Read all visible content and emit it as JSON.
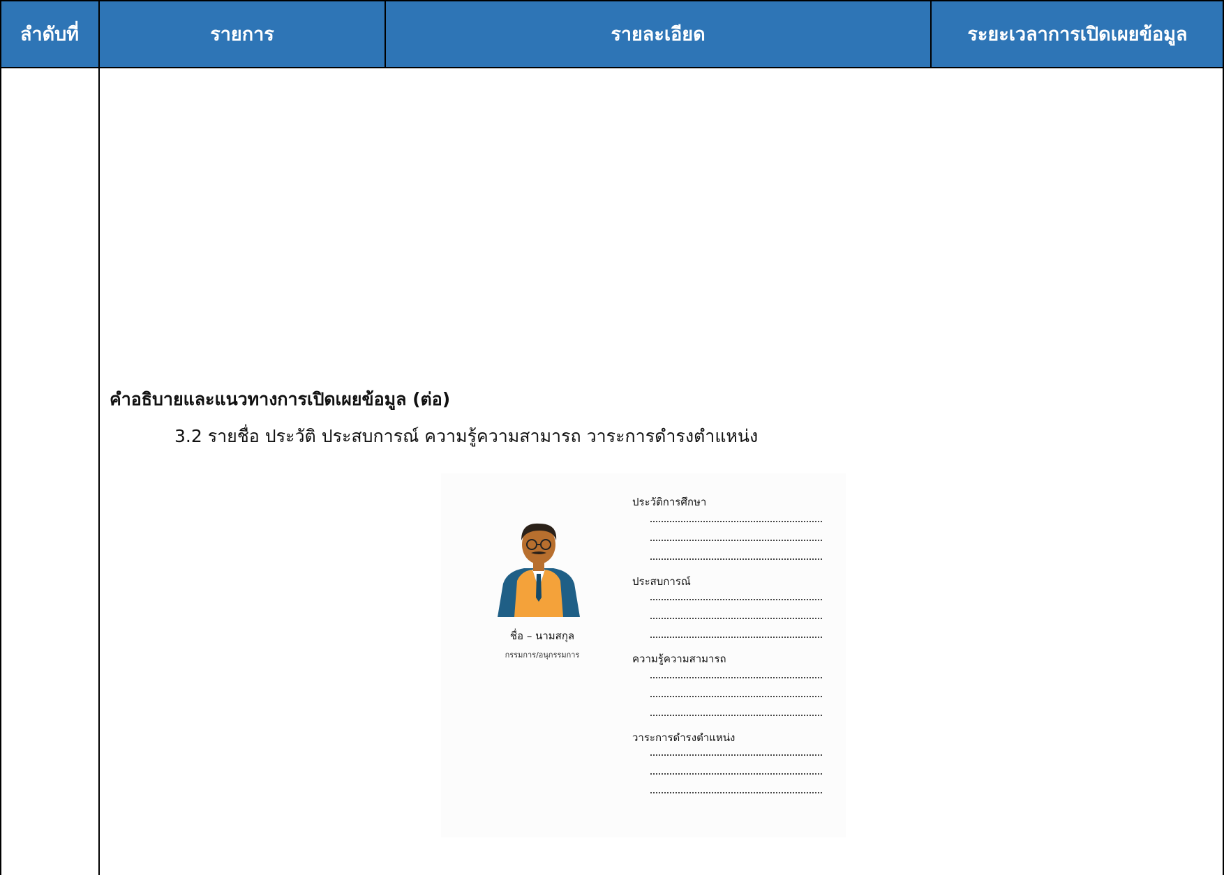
{
  "table": {
    "headers": {
      "order": "ลำดับที่",
      "item": "รายการ",
      "detail": "รายละเอียด",
      "period": "ระยะเวลาการเปิดเผยข้อมูล"
    }
  },
  "content": {
    "section_title": "คำอธิบายและแนวทางการเปิดเผยข้อมูล (ต่อ)",
    "section_line": "3.2 รายชื่อ ประวัติ ประสบการณ์ ความรู้ความสามารถ วาระการดำรงตำแหน่ง"
  },
  "illustration": {
    "person_name": "ชื่อ – นามสกุล",
    "person_role": "กรรมการ/อนุกรรมการ",
    "cv_sections": [
      "ประวัติการศึกษา",
      "ประสบการณ์",
      "ความรู้ความสามารถ",
      "วาระการดำรงตำแหน่ง"
    ],
    "colors": {
      "header_bg": "#2e75b6",
      "vest": "#f4a23a",
      "jacket": "#1f5f86",
      "skin": "#b86f2e"
    }
  }
}
